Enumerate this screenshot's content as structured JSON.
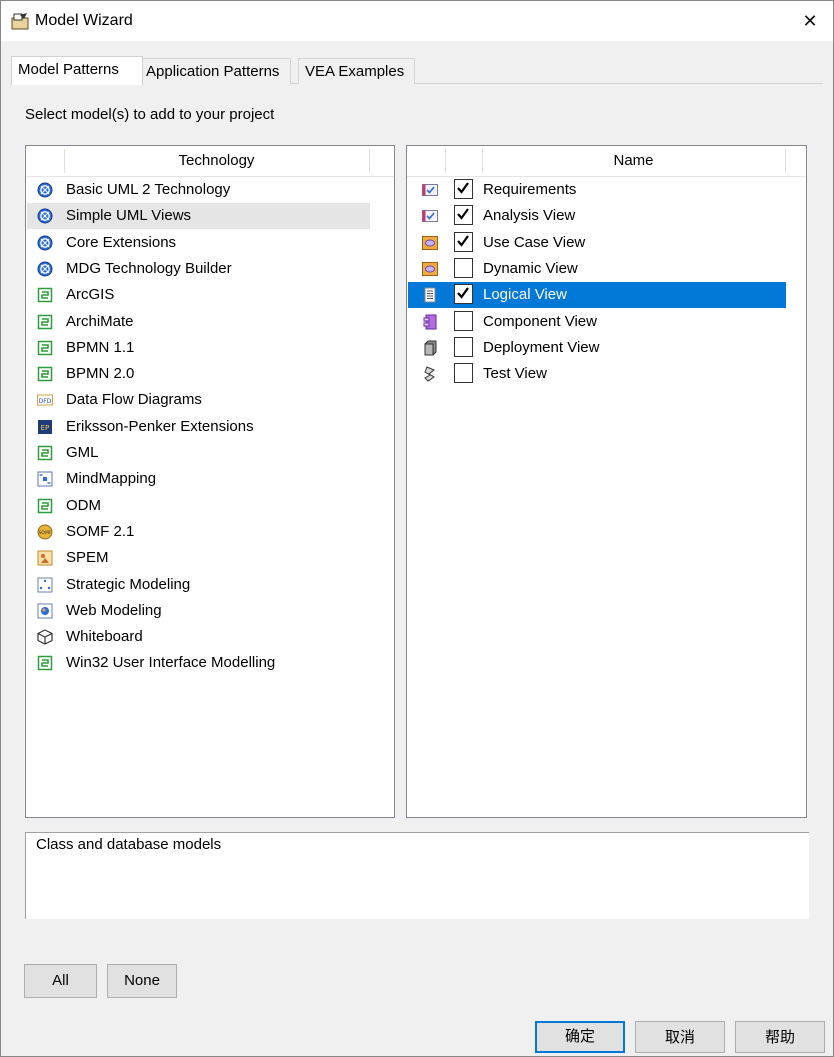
{
  "window": {
    "title": "Model Wizard",
    "close_glyph": "✕"
  },
  "tabs": [
    {
      "label": "Model Patterns",
      "active": true
    },
    {
      "label": "Application Patterns",
      "active": false
    },
    {
      "label": "VEA Examples",
      "active": false
    }
  ],
  "instruction": "Select model(s) to add to your project",
  "technology_list": {
    "header": "Technology",
    "items": [
      {
        "label": "Basic UML 2 Technology",
        "icon": "uml-icon",
        "selected": false
      },
      {
        "label": "Simple UML Views",
        "icon": "uml-icon",
        "selected": true
      },
      {
        "label": "Core Extensions",
        "icon": "uml-icon",
        "selected": false
      },
      {
        "label": "MDG Technology Builder",
        "icon": "uml-icon",
        "selected": false
      },
      {
        "label": "ArcGIS",
        "icon": "mdg-icon",
        "selected": false
      },
      {
        "label": "ArchiMate",
        "icon": "mdg-icon",
        "selected": false
      },
      {
        "label": "BPMN 1.1",
        "icon": "mdg-icon",
        "selected": false
      },
      {
        "label": "BPMN 2.0",
        "icon": "mdg-icon",
        "selected": false
      },
      {
        "label": "Data Flow Diagrams",
        "icon": "dfd-icon",
        "selected": false
      },
      {
        "label": "Eriksson-Penker Extensions",
        "icon": "ep-icon",
        "selected": false
      },
      {
        "label": "GML",
        "icon": "mdg-icon",
        "selected": false
      },
      {
        "label": "MindMapping",
        "icon": "mindmap-icon",
        "selected": false
      },
      {
        "label": "ODM",
        "icon": "mdg-icon",
        "selected": false
      },
      {
        "label": "SOMF 2.1",
        "icon": "somf-icon",
        "selected": false
      },
      {
        "label": "SPEM",
        "icon": "spem-icon",
        "selected": false
      },
      {
        "label": "Strategic Modeling",
        "icon": "strategic-icon",
        "selected": false
      },
      {
        "label": "Web Modeling",
        "icon": "web-icon",
        "selected": false
      },
      {
        "label": "Whiteboard",
        "icon": "cube-icon",
        "selected": false
      },
      {
        "label": "Win32 User Interface Modelling",
        "icon": "mdg-icon",
        "selected": false
      }
    ]
  },
  "name_list": {
    "header": "Name",
    "items": [
      {
        "label": "Requirements",
        "icon": "requirements-icon",
        "checked": true,
        "selected": false
      },
      {
        "label": "Analysis View",
        "icon": "requirements-icon",
        "checked": true,
        "selected": false
      },
      {
        "label": "Use Case View",
        "icon": "usecase-icon",
        "checked": true,
        "selected": false
      },
      {
        "label": "Dynamic View",
        "icon": "usecase-icon",
        "checked": false,
        "selected": false
      },
      {
        "label": "Logical View",
        "icon": "logical-icon",
        "checked": true,
        "selected": true
      },
      {
        "label": "Component View",
        "icon": "component-icon",
        "checked": false,
        "selected": false
      },
      {
        "label": "Deployment View",
        "icon": "deployment-icon",
        "checked": false,
        "selected": false
      },
      {
        "label": "Test View",
        "icon": "test-icon",
        "checked": false,
        "selected": false
      }
    ]
  },
  "description": "Class and database models",
  "buttons": {
    "all": "All",
    "none": "None",
    "ok": "确定",
    "cancel": "取消",
    "help": "帮助"
  },
  "colors": {
    "selection": "#0078d7",
    "tech_selected": "#e5e5e5",
    "dialog_bg": "#f0f0f0",
    "border": "#828790"
  }
}
